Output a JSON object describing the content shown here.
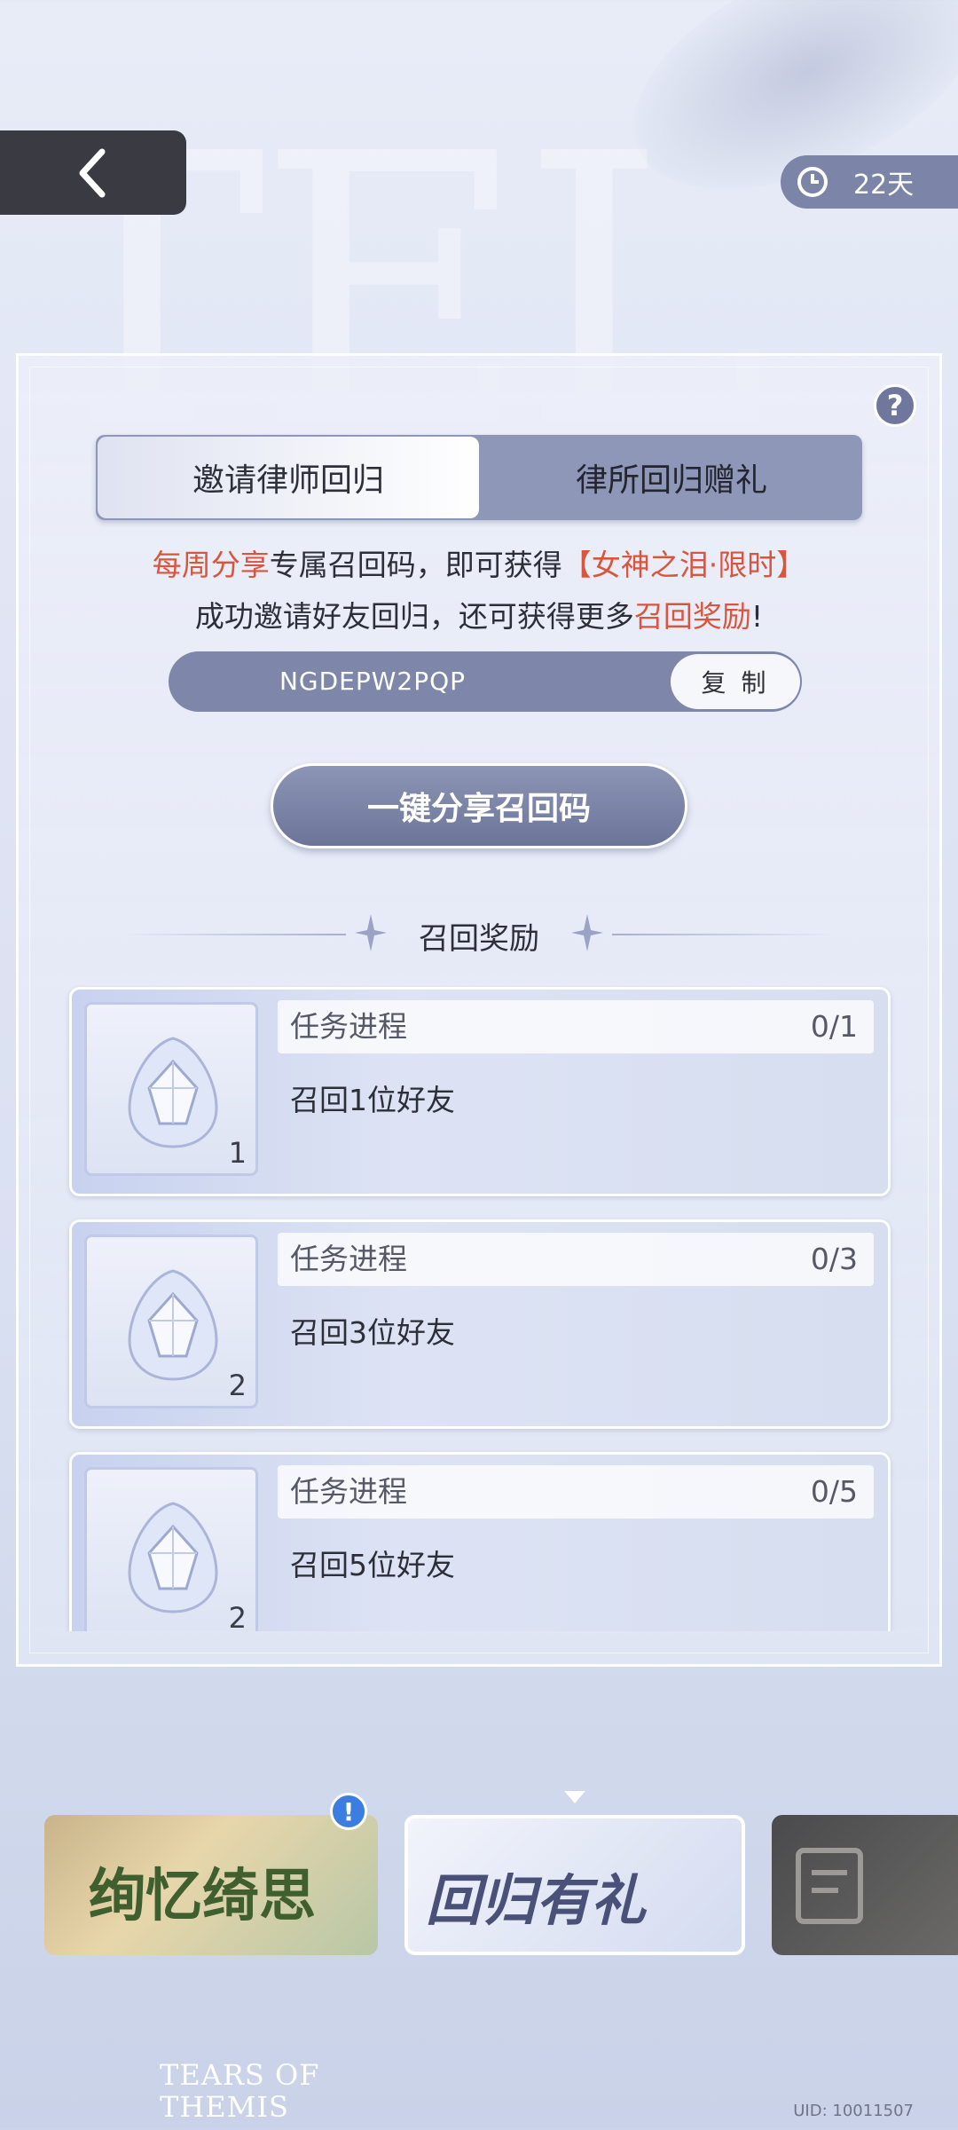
{
  "header": {
    "timer_value": "22天"
  },
  "tabs": [
    {
      "label": "邀请律师回归",
      "active": true
    },
    {
      "label": "律所回归赠礼",
      "active": false
    }
  ],
  "description": {
    "line1_red1": "每周分享",
    "line1_mid": "专属召回码，即可获得",
    "line1_red2": "【女神之泪·限时】",
    "line2_start": "成功邀请好友回归，还可获得更多",
    "line2_red": "召回奖励",
    "line2_end": "!"
  },
  "code": {
    "value": "NGDEPW2PQP",
    "copy_label": "复 制"
  },
  "share_button": "一键分享召回码",
  "section_title": "召回奖励",
  "tasks": [
    {
      "progress_label": "任务进程",
      "progress": "0/1",
      "title": "召回1位好友",
      "reward_qty": "1"
    },
    {
      "progress_label": "任务进程",
      "progress": "0/3",
      "title": "召回3位好友",
      "reward_qty": "2"
    },
    {
      "progress_label": "任务进程",
      "progress": "0/5",
      "title": "召回5位好友",
      "reward_qty": "2"
    }
  ],
  "banners": [
    {
      "text": "绚忆绮思"
    },
    {
      "text": "回归有礼"
    }
  ],
  "footer": {
    "logo_line1": "TEARS OF",
    "logo_line2": "THEMIS",
    "uid": "UID: 10011507"
  },
  "colors": {
    "accent": "#7e87aa",
    "highlight_red": "#d9553e"
  }
}
